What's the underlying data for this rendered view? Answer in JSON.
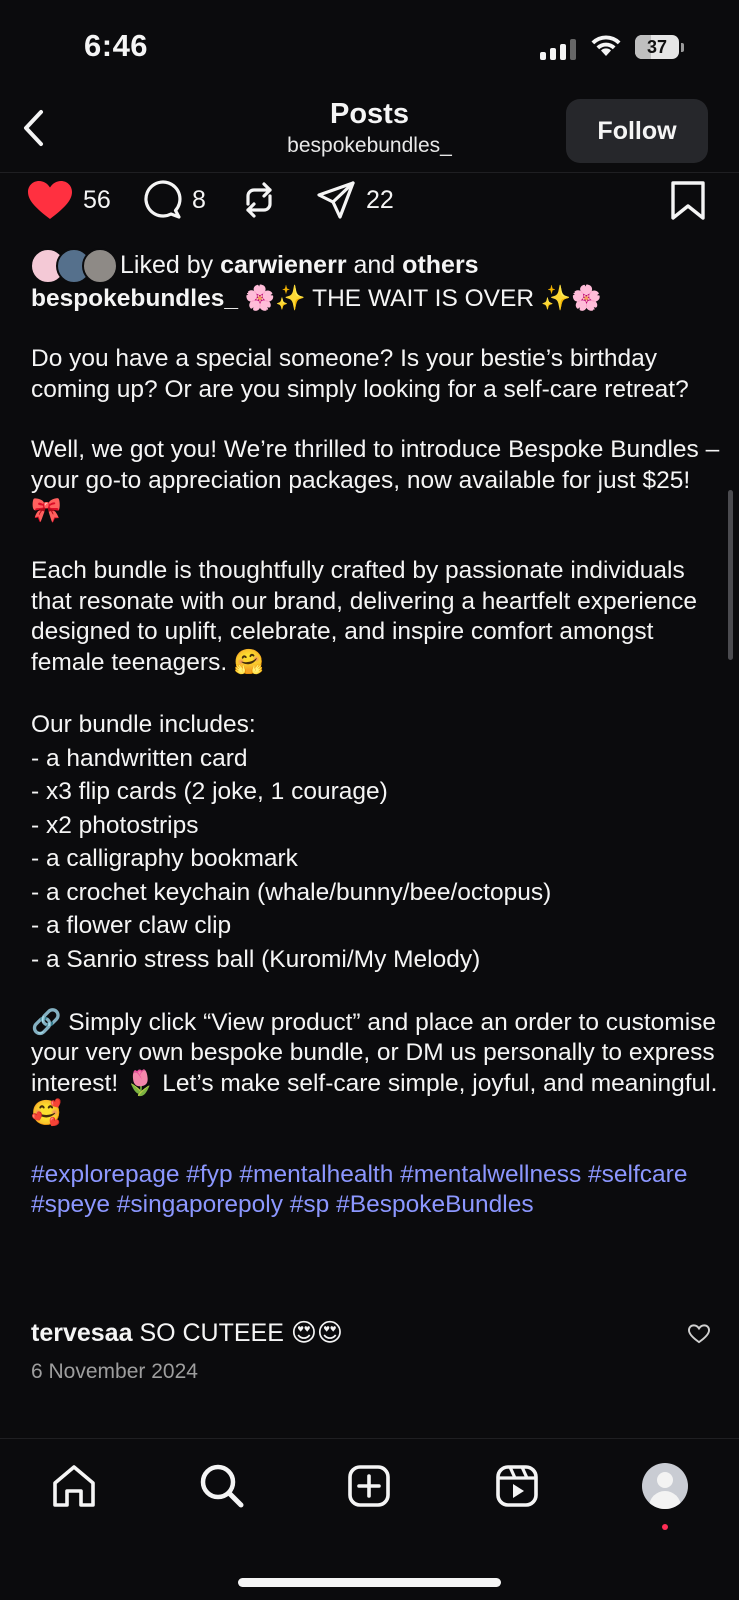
{
  "status_bar": {
    "time": "6:46",
    "battery": "37",
    "battery_level": 0.37
  },
  "header": {
    "title": "Posts",
    "username": "bespokebundles_",
    "follow_label": "Follow"
  },
  "actions": {
    "likes": "56",
    "comments": "8",
    "shares": "22"
  },
  "liked_by": {
    "prefix": "Liked by",
    "user": "carwienerr",
    "conjunction": "and",
    "others": "others"
  },
  "caption": {
    "username": "bespokebundles_",
    "headline": "🌸✨ THE WAIT IS OVER ✨🌸",
    "paragraphs": [
      "Do you have a special someone? Is your bestie’s birthday coming up? Or are you simply looking for a self-care retreat?",
      "Well, we got you! We’re thrilled to introduce Bespoke Bundles – your go-to appreciation packages, now available for just $25! 🎀",
      "Each bundle is thoughtfully crafted by passionate individuals that resonate with our brand, delivering a heartfelt experience designed to uplift, celebrate, and inspire comfort amongst female teenagers. 🤗"
    ],
    "includes_title": "Our bundle includes:",
    "includes": [
      "- a handwritten card",
      "- x3 flip cards (2 joke, 1 courage)",
      "- x2 photostrips",
      "- a calligraphy bookmark",
      "- a crochet keychain (whale/bunny/bee/octopus)",
      "- a flower claw clip",
      "- a Sanrio stress ball (Kuromi/My Melody)"
    ],
    "cta": "🔗 Simply click “View product” and place an order to customise your very own bespoke bundle, or DM us personally to express interest! 🌷 Let’s make self-care simple, joyful, and meaningful. 🥰",
    "hashtags": "#explorepage #fyp #mentalhealth #mentalwellness #selfcare #speye #singaporepoly #sp #BespokeBundles"
  },
  "comment": {
    "username": "tervesaa",
    "text": "SO CUTEEE 😍😍"
  },
  "date": "6 November 2024",
  "colors": {
    "background": "#0b0b0d",
    "like_red": "#ff3040",
    "hashtag": "#8c97ff",
    "follow_bg": "#26272b"
  },
  "icons": [
    "back-chevron-icon",
    "heart-icon",
    "comment-icon",
    "repost-icon",
    "share-icon",
    "bookmark-icon",
    "home-icon",
    "search-icon",
    "create-icon",
    "reels-icon",
    "profile-icon"
  ]
}
